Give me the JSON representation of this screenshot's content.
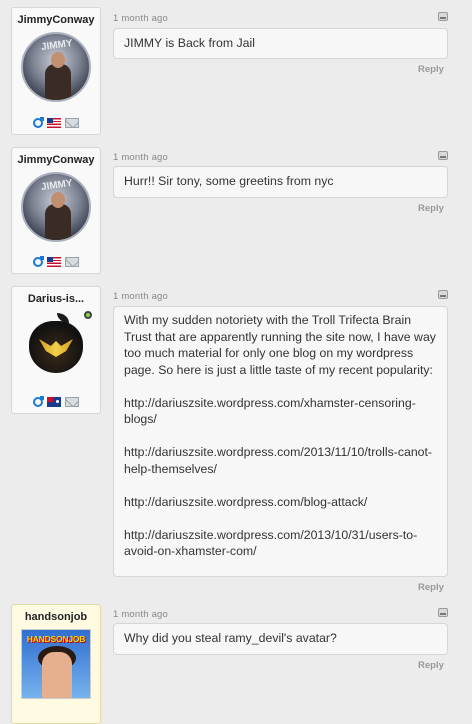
{
  "comments": [
    {
      "username": "JimmyConway",
      "time": "1 month ago",
      "text": "JIMMY is Back from Jail",
      "reply": "Reply",
      "avatar_text": "JIMMY",
      "gender_icon": "male-icon",
      "flag_icon": "us-flag-icon"
    },
    {
      "username": "JimmyConway",
      "time": "1 month ago",
      "text": "Hurr!! Sir tony, some greetins from nyc",
      "reply": "Reply",
      "avatar_text": "JIMMY",
      "gender_icon": "male-icon",
      "flag_icon": "us-flag-icon"
    },
    {
      "username": "Darius-is...",
      "time": "1 month ago",
      "paragraphs": [
        "With my sudden notoriety with the Troll Trifecta Brain Trust that are apparently running the site now, I have way too much material for only one blog on my wordpress page. So here is just a little taste of my recent popularity:",
        "http://dariuszsite.wordpress.com/xhamster-censoring-blogs/",
        "http://dariuszsite.wordpress.com/2013/11/10/trolls-canot-help-themselves/",
        "http://dariuszsite.wordpress.com/blog-attack/",
        "http://dariuszsite.wordpress.com/2013/10/31/users-to-avoid-on-xhamster-com/"
      ],
      "reply": "Reply",
      "gender_icon": "male-icon",
      "flag_icon": "au-flag-icon",
      "online": true
    },
    {
      "username": "handsonjob",
      "time": "1 month ago",
      "text": "Why did you steal ramy_devil's avatar?",
      "reply": "Reply",
      "avatar_text": "HANDSONJOB"
    }
  ],
  "colors": {
    "page_bg": "#ececec",
    "bubble_bg": "#f7f7f7",
    "border": "#d6d6d6",
    "username": "#222222",
    "meta": "#888888",
    "male_icon": "#1a7ad6"
  }
}
